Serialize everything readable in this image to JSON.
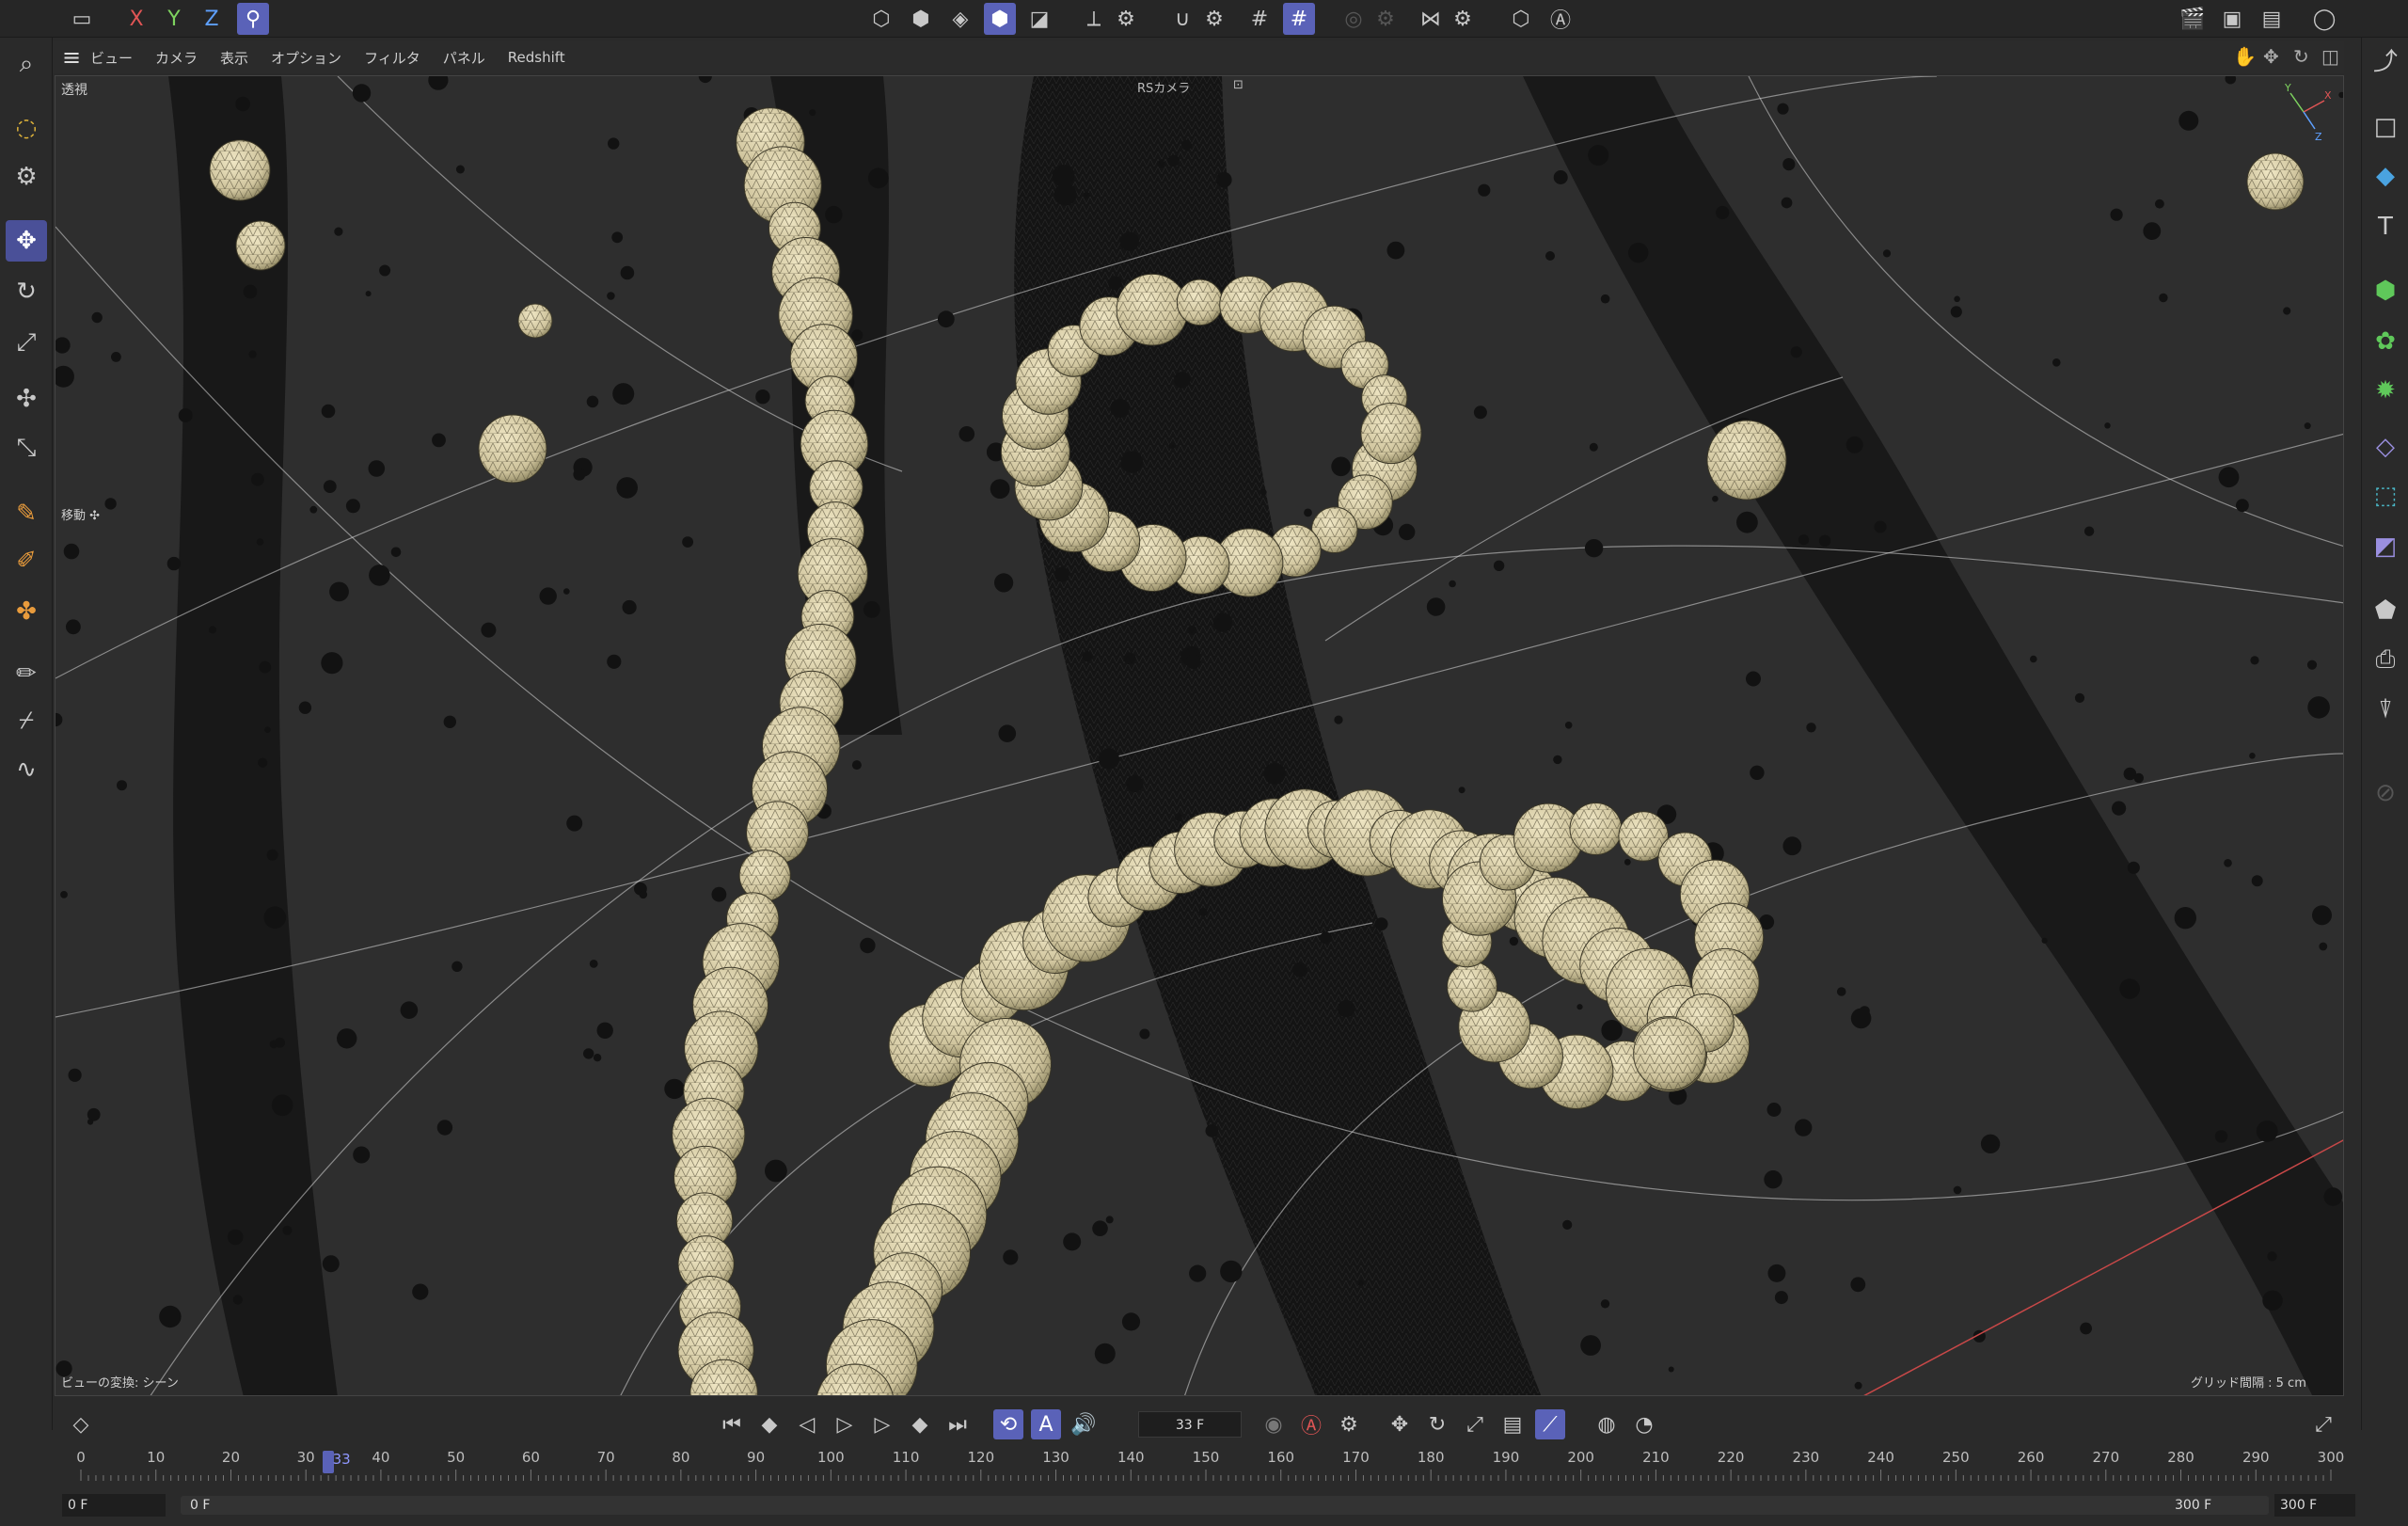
{
  "toolbar": {
    "axis_x": "X",
    "axis_y": "Y",
    "axis_z": "Z",
    "colors": {
      "x": "#e05555",
      "y": "#7ed35f",
      "z": "#5ea0ff",
      "accent": "#5a62b8"
    }
  },
  "viewport_menu": {
    "items": [
      "ビュー",
      "カメラ",
      "表示",
      "オプション",
      "フィルタ",
      "パネル",
      "Redshift"
    ]
  },
  "viewport": {
    "view_name": "透視",
    "camera_name": "RSカメラ",
    "tool_label": "移動 ✣",
    "transform_label": "ビューの変換: シーン",
    "grid_spacing": "グリッド間隔 : 5 cm",
    "axis_labels": {
      "x": "X",
      "y": "Y",
      "z": "Z"
    }
  },
  "timeline": {
    "current_frame": "33 F",
    "current_frame_tick": "33",
    "ticks": [
      "0",
      "10",
      "20",
      "30",
      "40",
      "50",
      "60",
      "70",
      "80",
      "90",
      "100",
      "110",
      "120",
      "130",
      "140",
      "150",
      "160",
      "170",
      "180",
      "190",
      "200",
      "210",
      "220",
      "230",
      "240",
      "250",
      "260",
      "270",
      "280",
      "290",
      "300"
    ],
    "range_start": "0 F",
    "range_start_inner": "0 F",
    "range_end_inner": "300 F",
    "range_end": "300 F"
  }
}
